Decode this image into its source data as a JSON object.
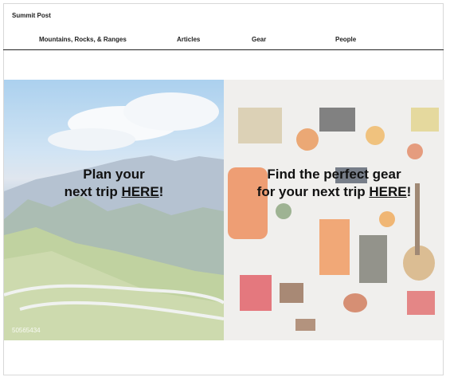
{
  "site": {
    "title": "Summit Post"
  },
  "nav": {
    "items": [
      {
        "label": "Mountains, Rocks, & Ranges"
      },
      {
        "label": "Articles"
      },
      {
        "label": "Gear"
      },
      {
        "label": "People"
      }
    ]
  },
  "hero": {
    "left": {
      "line1": "Plan your",
      "line2_prefix": "next trip ",
      "link": "HERE",
      "suffix": "!",
      "watermark": "50565434"
    },
    "right": {
      "line1": "Find the perfect gear",
      "line2_prefix": "for your next trip ",
      "link": "HERE",
      "suffix": "!"
    }
  }
}
